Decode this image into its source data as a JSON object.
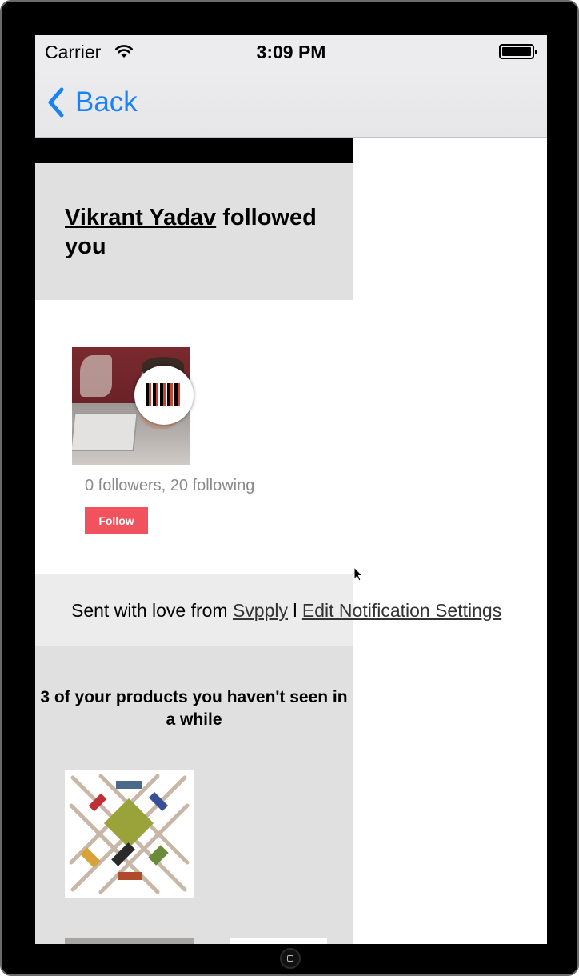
{
  "status_bar": {
    "carrier": "Carrier",
    "time": "3:09 PM",
    "wifi_icon": "wifi-icon",
    "battery_icon": "battery-icon"
  },
  "nav": {
    "back_label": "Back",
    "back_icon": "chevron-left-icon",
    "accent_color": "#1a82f7"
  },
  "notification": {
    "user_name": "Vikrant Yadav",
    "action_text": " followed you",
    "stats": "0 followers, 20 following",
    "follow_label": "Follow",
    "follow_color": "#f0535d"
  },
  "footer": {
    "prefix": "Sent with love from ",
    "svpply_link": "Svpply",
    "separator": " l ",
    "settings_link": "Edit Notification Settings"
  },
  "products": {
    "title": "3 of your products you haven't seen in a while"
  }
}
